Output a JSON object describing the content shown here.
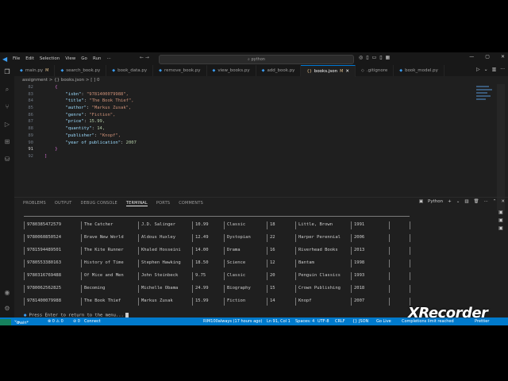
{
  "menu": [
    "File",
    "Edit",
    "Selection",
    "View",
    "Go",
    "Run"
  ],
  "command_center": "python",
  "tabs": [
    {
      "label": "main.py",
      "modified": "M",
      "active": false
    },
    {
      "label": "search_book.py",
      "modified": "",
      "active": false
    },
    {
      "label": "book_data.py",
      "modified": "",
      "active": false
    },
    {
      "label": "remove_book.py",
      "modified": "",
      "active": false
    },
    {
      "label": "view_books.py",
      "modified": "",
      "active": false
    },
    {
      "label": "add_book.py",
      "modified": "",
      "active": false
    },
    {
      "label": "books.json",
      "modified": "M",
      "active": true
    },
    {
      "label": ".gitignore",
      "modified": "",
      "active": false
    },
    {
      "label": "book_model.py",
      "modified": "",
      "active": false
    }
  ],
  "breadcrumb": "assignment > {} books.json > [ ] 0",
  "editor": {
    "line_numbers": [
      "82",
      "83",
      "84",
      "85",
      "86",
      "87",
      "88",
      "89",
      "90",
      "91",
      "92"
    ],
    "current_line": "91",
    "lines": [
      {
        "indent": "    ",
        "key": "{",
        "val": "",
        "kind": "brace"
      },
      {
        "indent": "        ",
        "key": "\"isbn\"",
        "val": "\"9781400079988\",",
        "kind": "str"
      },
      {
        "indent": "        ",
        "key": "\"title\"",
        "val": "\"The Book Thief\",",
        "kind": "str"
      },
      {
        "indent": "        ",
        "key": "\"author\"",
        "val": "\"Markus Zusak\",",
        "kind": "str"
      },
      {
        "indent": "        ",
        "key": "\"genre\"",
        "val": "\"Fiction\",",
        "kind": "str"
      },
      {
        "indent": "        ",
        "key": "\"price\"",
        "val": "15.99,",
        "kind": "num"
      },
      {
        "indent": "        ",
        "key": "\"quantity\"",
        "val": "14,",
        "kind": "num"
      },
      {
        "indent": "        ",
        "key": "\"publisher\"",
        "val": "\"Knopf\",",
        "kind": "str"
      },
      {
        "indent": "        ",
        "key": "\"year of publication\"",
        "val": "2007",
        "kind": "num"
      },
      {
        "indent": "    ",
        "key": "}",
        "val": "",
        "kind": "brace"
      },
      {
        "indent": "",
        "key": "]",
        "val": "",
        "kind": "brace"
      }
    ]
  },
  "panel_tabs": [
    "PROBLEMS",
    "OUTPUT",
    "DEBUG CONSOLE",
    "TERMINAL",
    "PORTS",
    "COMMENTS"
  ],
  "panel_active": "TERMINAL",
  "terminal_profile": "Python",
  "books": [
    {
      "isbn": "9780385472579",
      "title": "The Catcher",
      "author": "J.D. Salinger",
      "price": "10.99",
      "genre": "Classic",
      "qty": "18",
      "publisher": "Little, Brown",
      "year": "1991"
    },
    {
      "isbn": "9780060850524",
      "title": "Brave New World",
      "author": "Aldous Huxley",
      "price": "12.49",
      "genre": "Dystopian",
      "qty": "22",
      "publisher": "Harper Perennial",
      "year": "2006"
    },
    {
      "isbn": "9781594489501",
      "title": "The Kite Runner",
      "author": "Khaled Hosseini",
      "price": "14.00",
      "genre": "Drama",
      "qty": "16",
      "publisher": "Riverhead Books",
      "year": "2013"
    },
    {
      "isbn": "9780553380163",
      "title": "History of Time",
      "author": "Stephen Hawking",
      "price": "18.50",
      "genre": "Science",
      "qty": "12",
      "publisher": "Bantam",
      "year": "1998"
    },
    {
      "isbn": "9780316769488",
      "title": "Of Mice and Men",
      "author": "John Steinbeck",
      "price": "9.75",
      "genre": "Classic",
      "qty": "20",
      "publisher": "Penguin Classics",
      "year": "1993"
    },
    {
      "isbn": "9780062562825",
      "title": "Becoming",
      "author": "Michelle Obama",
      "price": "24.99",
      "genre": "Biography",
      "qty": "15",
      "publisher": "Crown Publishing",
      "year": "2018"
    },
    {
      "isbn": "9781400079988",
      "title": "The Book Thief",
      "author": "Markus Zusak",
      "price": "15.99",
      "genre": "Fiction",
      "qty": "14",
      "publisher": "Knopf",
      "year": "2007"
    }
  ],
  "terminal_prompt": "Press Enter to return to the menu...",
  "status": {
    "branch": "main*",
    "sync": "⟳",
    "errors": "⊗ 0 ⚠ 0",
    "ports": "⊘ 0",
    "connect": "Connect",
    "git_author": "RIM100always (17 hours ago)",
    "position": "Ln 91, Col 1",
    "spaces": "Spaces: 4",
    "encoding": "UTF-8",
    "eol": "CRLF",
    "language": "{} JSON",
    "golive": "Go Live",
    "completions": "Completions limit reached",
    "prettier": "Prettier"
  },
  "watermark": "XRecorder"
}
